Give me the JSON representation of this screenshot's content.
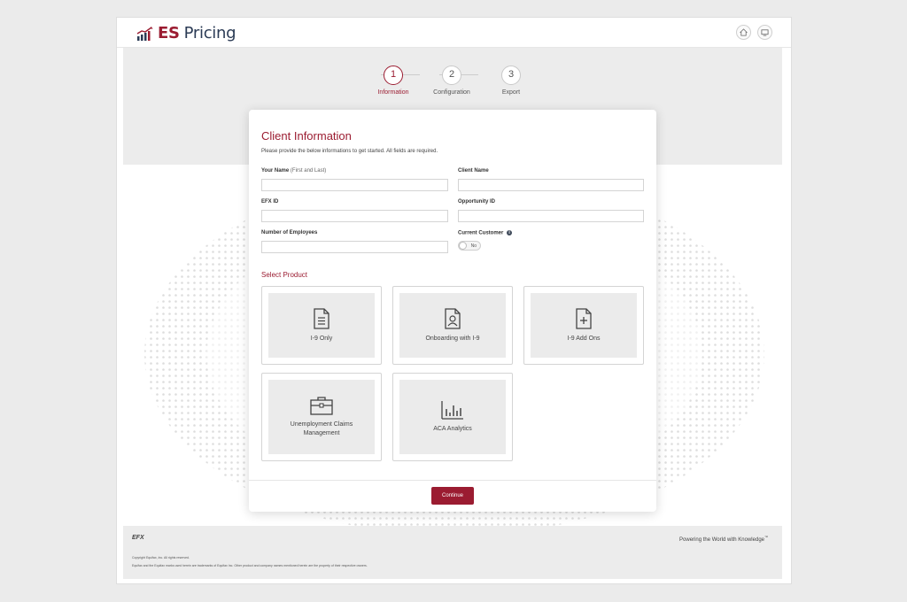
{
  "app": {
    "brand_es": "ES",
    "brand_pricing": "Pricing"
  },
  "stepper": {
    "steps": [
      {
        "number": "1",
        "label": "Information",
        "active": true
      },
      {
        "number": "2",
        "label": "Configuration",
        "active": false
      },
      {
        "number": "3",
        "label": "Export",
        "active": false
      }
    ]
  },
  "form": {
    "title": "Client Information",
    "subtitle": "Please provide the below informations to get started. All fields are required.",
    "your_name_label": "Your Name",
    "your_name_hint": "(First and Last)",
    "your_name_value": "",
    "client_name_label": "Client Name",
    "client_name_value": "",
    "efx_id_label": "EFX ID",
    "efx_id_value": "",
    "opportunity_id_label": "Opportunity ID",
    "opportunity_id_value": "",
    "employees_label": "Number of Employees",
    "employees_value": "",
    "current_customer_label": "Current Customer",
    "current_customer_info": "i",
    "current_customer_value": "No"
  },
  "products": {
    "section_title": "Select Product",
    "items": [
      {
        "label": "I-9 Only",
        "icon": "document-icon"
      },
      {
        "label": "Onboarding with I-9",
        "icon": "person-badge-icon"
      },
      {
        "label": "I-9 Add Ons",
        "icon": "document-plus-icon"
      },
      {
        "label": "Unemployment Claims Management",
        "icon": "briefcase-icon"
      },
      {
        "label": "ACA Analytics",
        "icon": "bar-chart-icon"
      }
    ]
  },
  "actions": {
    "continue_label": "Continue"
  },
  "footer": {
    "logo": "EFX",
    "tagline": "Powering the World with Knowledge",
    "tagline_mark": "™",
    "copyright": "Copyright Equifax, Inc. All rights reserved.",
    "legal": "Equifax and the Equifax marks used herein are trademarks of Equifax Inc. Other product and company names mentioned herein are the property of their respective owners."
  },
  "colors": {
    "brand": "#9b1c31",
    "navy": "#2b3b55",
    "panel_gray": "#ececec"
  }
}
